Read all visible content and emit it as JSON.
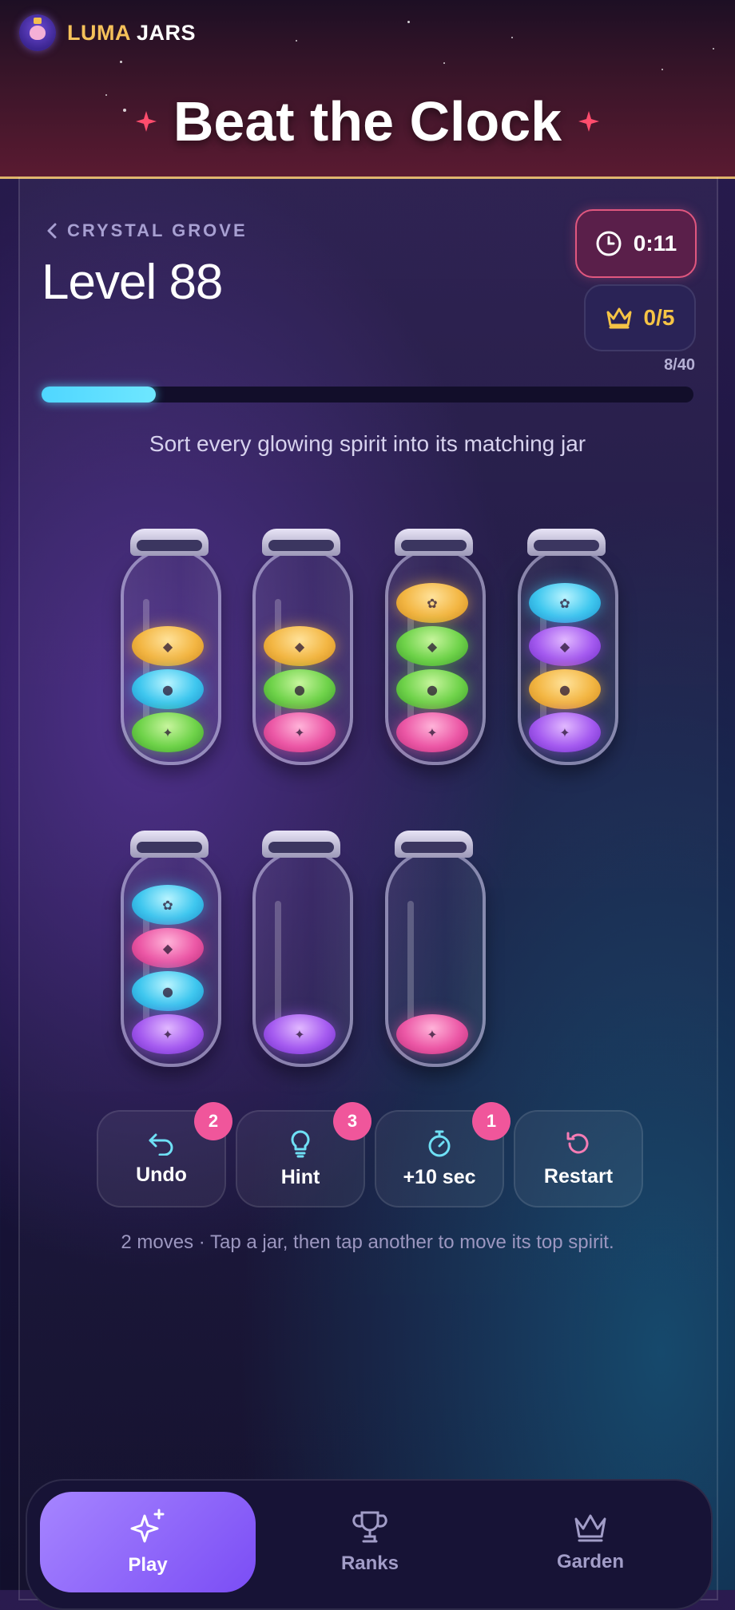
{
  "app": {
    "brand_word1": "LUMA",
    "brand_word2": "JARS"
  },
  "header": {
    "title": "Beat the Clock"
  },
  "level": {
    "back_label": "CRYSTAL GROVE",
    "title": "Level 88",
    "timer": "0:11",
    "score": "0/5",
    "progress_text": "8/40",
    "progress_fraction": 0.175
  },
  "instruction": "Sort every glowing spirit into its matching jar",
  "jars": [
    {
      "spirits": [
        "gold",
        "cyan",
        "green"
      ],
      "glyphs": [
        "◆",
        "●",
        "✦"
      ]
    },
    {
      "spirits": [
        "gold",
        "green",
        "pink"
      ],
      "glyphs": [
        "◆",
        "●",
        "✦"
      ]
    },
    {
      "spirits": [
        "gold",
        "green",
        "green",
        "pink"
      ],
      "glyphs": [
        "✿",
        "◆",
        "●",
        "✦"
      ]
    },
    {
      "spirits": [
        "cyan",
        "purple",
        "gold",
        "purple"
      ],
      "glyphs": [
        "✿",
        "◆",
        "●",
        "✦"
      ]
    },
    {
      "spirits": [
        "cyan",
        "pink",
        "cyan",
        "purple"
      ],
      "glyphs": [
        "✿",
        "◆",
        "●",
        "✦"
      ]
    },
    {
      "spirits": [
        "purple"
      ],
      "glyphs": [
        "✦"
      ]
    },
    {
      "spirits": [
        "pink"
      ],
      "glyphs": [
        "✦"
      ]
    }
  ],
  "actions": [
    {
      "label": "Undo",
      "badge": "2",
      "icon": "undo-icon"
    },
    {
      "label": "Hint",
      "badge": "3",
      "icon": "lightbulb-icon"
    },
    {
      "label": "+10 sec",
      "badge": "1",
      "icon": "stopwatch-icon"
    },
    {
      "label": "Restart",
      "badge": "",
      "icon": "restart-icon"
    }
  ],
  "footer_hint": "2 moves · Tap a jar, then tap another to move its top spirit.",
  "nav": [
    {
      "label": "Play",
      "icon": "sparkles-icon",
      "active": true
    },
    {
      "label": "Ranks",
      "icon": "trophy-icon",
      "active": false
    },
    {
      "label": "Garden",
      "icon": "crown-icon",
      "active": false
    }
  ],
  "colors": {
    "accent_gold": "#f5c15a",
    "timer_border": "#e0577f",
    "progress": "#4fd6ff",
    "badge": "#f0569b",
    "nav_active": "#8b62f8"
  }
}
